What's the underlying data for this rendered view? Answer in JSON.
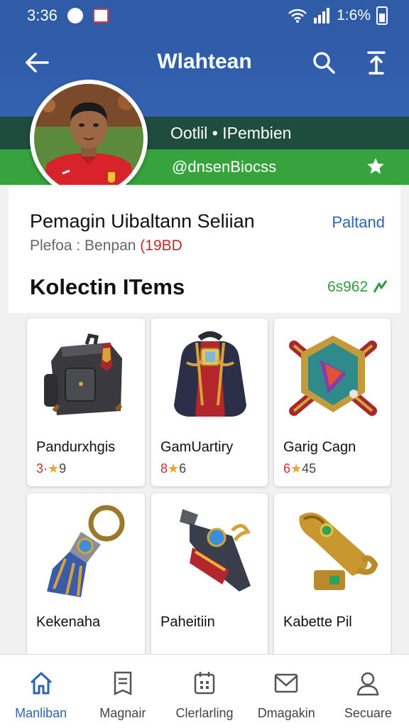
{
  "status": {
    "time": "3:36",
    "battery": "1:6%"
  },
  "app_bar": {
    "title": "Wlahtean"
  },
  "team": {
    "label": "Ootlil • IPembien",
    "handle": "@dnsenBiocss"
  },
  "profile": {
    "name": "Pemagin Uibaltann Seliian",
    "position_prefix": "Plefoa : Benpan ",
    "position_year": "(19BD",
    "edit": "Paltand"
  },
  "section": {
    "title": "Kolectin ITems",
    "count": "6s962"
  },
  "items": [
    {
      "name": "Pandurxhgis",
      "rating_pre": "3·",
      "rating_post": "9"
    },
    {
      "name": "GamUartiry",
      "rating_pre": "8",
      "rating_post": "6"
    },
    {
      "name": "Garig Cagn",
      "rating_pre": "6",
      "rating_post": "45"
    },
    {
      "name": "Kekenaha",
      "rating_pre": "",
      "rating_post": ""
    },
    {
      "name": "Paheitiin",
      "rating_pre": "",
      "rating_post": ""
    },
    {
      "name": "Kabette Pil",
      "rating_pre": "",
      "rating_post": ""
    }
  ],
  "nav": [
    {
      "label": "Manliban",
      "icon": "home-icon"
    },
    {
      "label": "Magnair",
      "icon": "document-icon"
    },
    {
      "label": "Clerlarling",
      "icon": "calendar-icon"
    },
    {
      "label": "Dmagakin",
      "icon": "mail-icon"
    },
    {
      "label": "Secuare",
      "icon": "profile-icon"
    }
  ],
  "colors": {
    "primary": "#2f5ba7",
    "team_band": "#1f4d3d",
    "accent_green": "#36a33d",
    "link_blue": "#2f64b0",
    "rating_red": "#d32f2f"
  }
}
